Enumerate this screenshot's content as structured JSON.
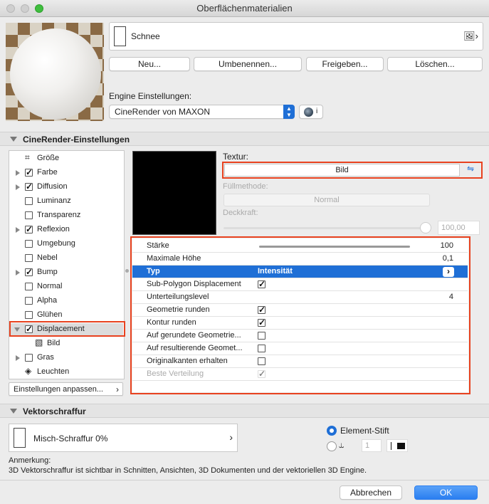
{
  "window": {
    "title": "Oberflächenmaterialien"
  },
  "material": {
    "name": "Schnee"
  },
  "buttons": {
    "new": "Neu...",
    "rename": "Umbenennen...",
    "share": "Freigeben...",
    "delete": "Löschen..."
  },
  "engine": {
    "label": "Engine Einstellungen:",
    "selected": "CineRender von MAXON"
  },
  "cinerender": {
    "header": "CineRender-Einstellungen"
  },
  "sidebar": {
    "items": [
      {
        "label": "Größe"
      },
      {
        "label": "Farbe",
        "checked": true
      },
      {
        "label": "Diffusion",
        "checked": true
      },
      {
        "label": "Luminanz",
        "checked": false
      },
      {
        "label": "Transparenz",
        "checked": false
      },
      {
        "label": "Reflexion",
        "checked": true
      },
      {
        "label": "Umgebung",
        "checked": false
      },
      {
        "label": "Nebel",
        "checked": false
      },
      {
        "label": "Bump",
        "checked": true
      },
      {
        "label": "Normal",
        "checked": false
      },
      {
        "label": "Alpha",
        "checked": false
      },
      {
        "label": "Glühen",
        "checked": false
      },
      {
        "label": "Displacement",
        "checked": true
      },
      {
        "label": "Bild"
      },
      {
        "label": "Gras",
        "checked": false
      },
      {
        "label": "Leuchten"
      }
    ],
    "customize": "Einstellungen anpassen..."
  },
  "texture": {
    "label": "Textur:",
    "value": "Bild",
    "fill_label": "Füllmethode:",
    "fill_value": "Normal",
    "opacity_label": "Deckkraft:",
    "opacity_value": "100,00"
  },
  "props": {
    "rows": [
      {
        "label": "Stärke",
        "value": "100"
      },
      {
        "label": "Maximale Höhe",
        "value": "0,1"
      },
      {
        "label": "Typ",
        "value": "Intensität"
      },
      {
        "label": "Sub-Polygon Displacement",
        "checked": true
      },
      {
        "label": "Unterteilungslevel",
        "value": "4"
      },
      {
        "label": "Geometrie runden",
        "checked": true
      },
      {
        "label": "Kontur runden",
        "checked": true
      },
      {
        "label": "Auf gerundete Geometrie...",
        "checked": false
      },
      {
        "label": "Auf resultierende Geomet...",
        "checked": false
      },
      {
        "label": "Originalkanten erhalten",
        "checked": false
      },
      {
        "label": "Beste Verteilung",
        "checked": true
      }
    ]
  },
  "vector": {
    "header": "Vektorschraffur",
    "fill": "Misch-Schraffur 0%",
    "radio_pen": "Element-Stift",
    "pen_number": "1",
    "note_label": "Anmerkung:",
    "note_text": "3D Vektorschraffur ist sichtbar in Schnitten, Ansichten, 3D Dokumenten und der vektoriellen 3D Engine."
  },
  "footer": {
    "cancel": "Abbrechen",
    "ok": "OK"
  },
  "colors": {
    "accent": "#1f6fd6",
    "highlight": "#e8421f"
  }
}
